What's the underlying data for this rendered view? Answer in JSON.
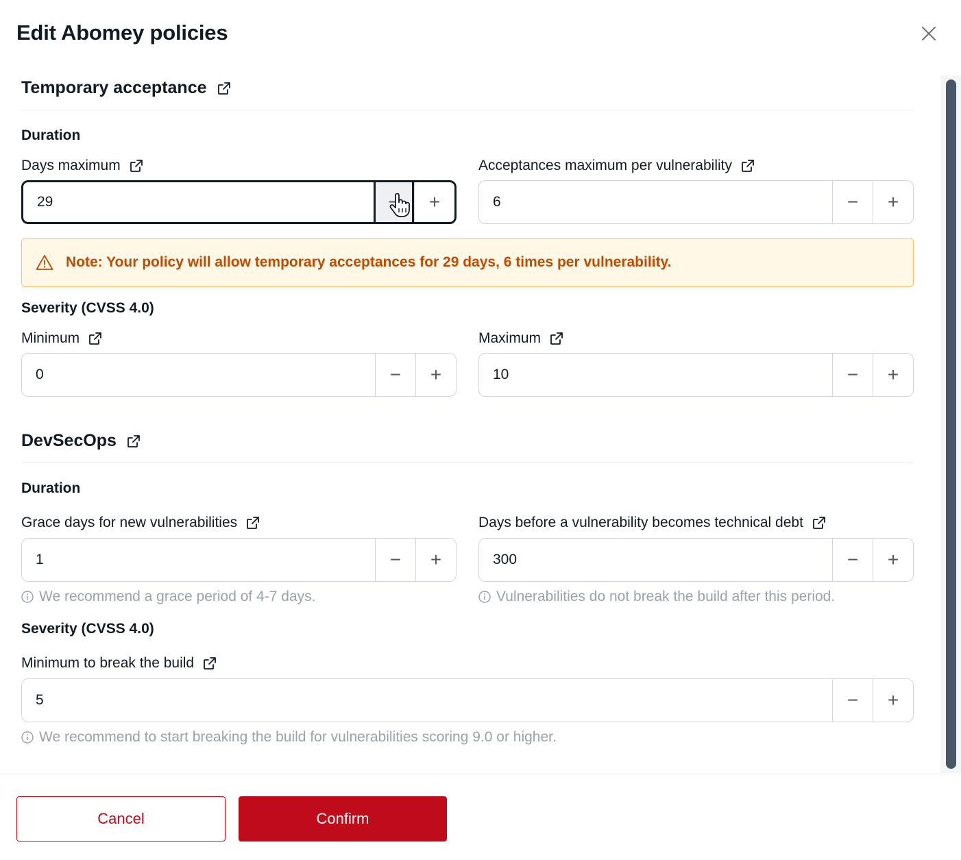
{
  "modal": {
    "title": "Edit Abomey policies",
    "close_icon": "close-icon"
  },
  "temporary_acceptance": {
    "title": "Temporary acceptance",
    "duration_heading": "Duration",
    "days_maximum": {
      "label": "Days maximum",
      "value": "29",
      "state": "focused"
    },
    "acceptances_maximum": {
      "label": "Acceptances maximum per vulnerability",
      "value": "6"
    },
    "note": "Note: Your policy will allow temporary acceptances for 29 days, 6 times per vulnerability.",
    "severity_heading": "Severity (CVSS 4.0)",
    "minimum": {
      "label": "Minimum",
      "value": "0"
    },
    "maximum": {
      "label": "Maximum",
      "value": "10"
    }
  },
  "devsecops": {
    "title": "DevSecOps",
    "duration_heading": "Duration",
    "grace_days": {
      "label": "Grace days for new vulnerabilities",
      "value": "1",
      "hint": "We recommend a grace period of 4-7 days."
    },
    "tech_debt_days": {
      "label": "Days before a vulnerability becomes technical debt",
      "value": "300",
      "hint": "Vulnerabilities do not break the build after this period."
    },
    "severity_heading": "Severity (CVSS 4.0)",
    "min_break_build": {
      "label": "Minimum to break the build",
      "value": "5",
      "hint": "We recommend to start breaking the build for vulnerabilities scoring 9.0 or higher."
    }
  },
  "stepper_symbols": {
    "minus": "−",
    "plus": "+"
  },
  "footer": {
    "cancel_label": "Cancel",
    "confirm_label": "Confirm"
  },
  "colors": {
    "accent": "#bf0b1a",
    "warning_text": "#bf4b00",
    "warning_bg": "#fff8e6",
    "warning_border": "#f3c267",
    "scrollbar": "#4a5568"
  },
  "icons": {
    "external_link": "external-link-icon",
    "warning": "warning-icon",
    "info": "info-icon",
    "cursor": "hand-pointer-icon"
  }
}
